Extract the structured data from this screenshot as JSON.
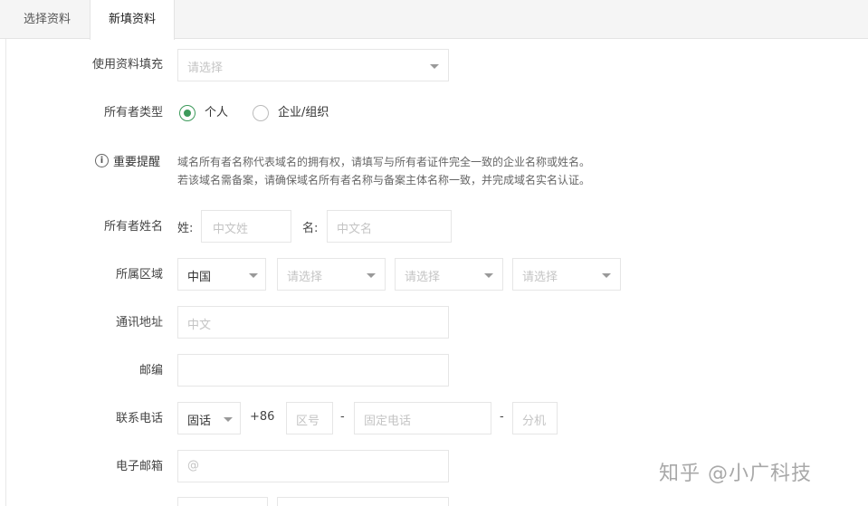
{
  "tabs": [
    {
      "label": "选择资料"
    },
    {
      "label": "新填资料"
    }
  ],
  "fill_from_profile": {
    "label": "使用资料填充",
    "placeholder": "请选择"
  },
  "owner_type": {
    "label": "所有者类型",
    "options": [
      "个人",
      "企业/组织"
    ],
    "selected": "个人"
  },
  "notice": {
    "label": "重要提醒",
    "line1": "域名所有者名称代表域名的拥有权，请填写与所有者证件完全一致的企业名称或姓名。",
    "line2": "若该域名需备案，请确保域名所有者名称与备案主体名称一致，并完成域名实名认证。"
  },
  "owner_name": {
    "label": "所有者姓名",
    "surname_label": "姓:",
    "surname_placeholder": "中文姓",
    "given_label": "名:",
    "given_placeholder": "中文名"
  },
  "region": {
    "label": "所属区域",
    "country": "中国",
    "province_placeholder": "请选择",
    "city_placeholder": "请选择",
    "district_placeholder": "请选择"
  },
  "address": {
    "label": "通讯地址",
    "placeholder": "中文"
  },
  "postcode": {
    "label": "邮编",
    "placeholder": ""
  },
  "phone": {
    "label": "联系电话",
    "type": "固话",
    "country_code": "+86",
    "area_placeholder": "区号",
    "sep1": "-",
    "number_placeholder": "固定电话",
    "sep2": "-",
    "ext_placeholder": "分机"
  },
  "email": {
    "label": "电子邮箱",
    "placeholder": "@"
  },
  "watermark": "知乎 @小广科技",
  "colors": {
    "radio_selected": "#3d9a5b",
    "tab_bar": "#f5f5f5"
  }
}
